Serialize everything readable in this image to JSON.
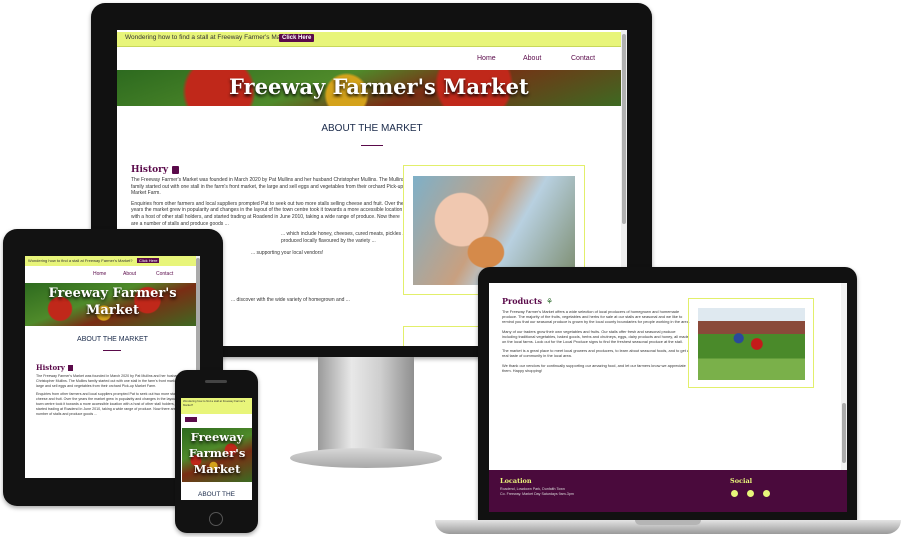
{
  "banner": {
    "text": "Wondering how to find a stall at Freeway Farmer's Market?",
    "button": "Click Here"
  },
  "nav": {
    "home": "Home",
    "about": "About",
    "contact": "Contact"
  },
  "site_title": "Freeway Farmer's Market",
  "site_title_line1": "Freeway Farmer's",
  "site_title_line2": "Market",
  "site_title_m_line1": "Freeway",
  "site_title_m_line2": "Farmer's",
  "site_title_m_line3": "Market",
  "about_heading": "ABOUT THE MARKET",
  "about_heading_m": "ABOUT THE",
  "history": {
    "heading": "History",
    "p1": "The Freeway Farmer's Market was founded in March 2020 by Pat Mullins and her husband Christopher Mullins. The Mullins family started out with one stall in the farm's front market, the large and sell eggs and vegetables from their orchard Pick-up Market Farm.",
    "p2": "Enquiries from other farmers and local suppliers prompted Pat to seek out two more stalls selling cheese and fruit. Over the years the market grew in popularity and changes in the layout of the town centre took it towards a more accessible location with a host of other stall holders, and started trading at Roadend in June 2010, taking a wide range of produce. Now there are a number of stalls and produce goods ...",
    "p3": "... which include honey, cheeses, cured meats, pickles ... produced locally flavoured by the variety ...",
    "p4": "... supporting your local vendors!",
    "p5": "... discover with the wide variety of homegrown and ..."
  },
  "products": {
    "heading": "Products",
    "p1": "The Freeway Farmer's Market offers a wide selection of local producers of homegrown and homemade produce. The majority of the fruits, vegetables and herbs for sale at our stalls are seasonal and we like to remind you that our seasonal produce is grown by the local county boundaries for people working in the area.",
    "p2": "Many of our traders grow their own vegetables and fruits. Our stalls offer fresh and seasonal produce including traditional vegetables, baked goods, herbs and chutneys, eggs, dairy products and honey, all made on the local farms. Look out for the Local Produce signs to find the freshest seasonal produce at the stall.",
    "p3": "The market is a great place to meet local growers and producers, to learn about seasonal foods, and to get a real taste of community in the local area.",
    "p4": "We thank our vendors for continually supporting our amazing food, and let our farmers know we appreciate them. Happy shopping!"
  },
  "footer": {
    "location_heading": "Location",
    "location_line1": "Roadend, Lowdown Park, Dunfaith Town",
    "location_line2": "Co. Freeway. Market Day Saturdays 9am-3pm",
    "social_heading": "Social"
  },
  "colors": {
    "accent": "#5a0a4a",
    "banner": "#e8f57a",
    "border": "#e2ef6b",
    "footer": "#4a0a3c"
  }
}
